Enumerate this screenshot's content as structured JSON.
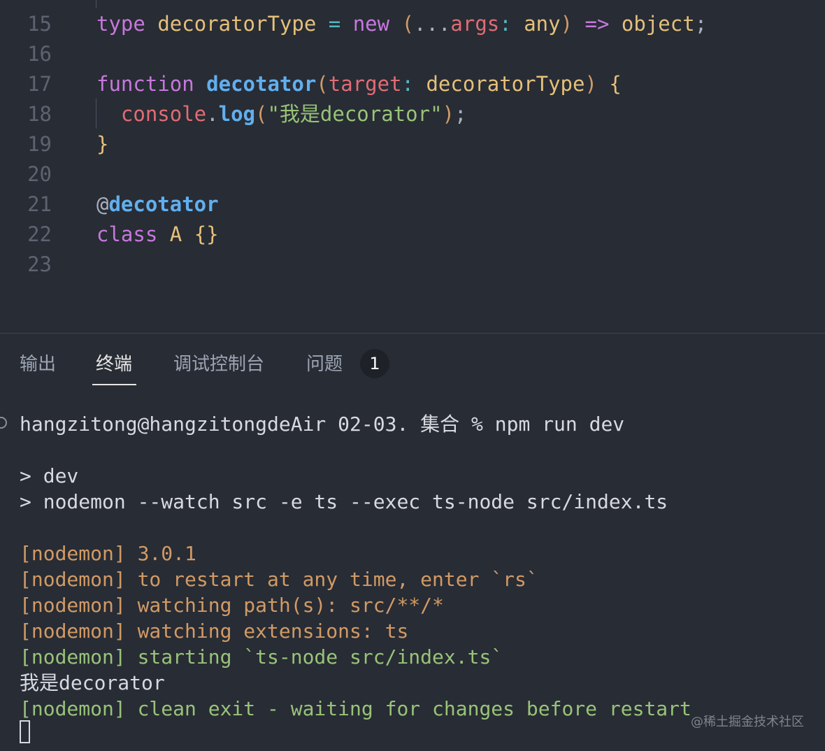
{
  "editor": {
    "lines": [
      {
        "num": "15",
        "tokens": [
          {
            "t": "type",
            "c": "kw"
          },
          {
            "t": " ",
            "c": "pl"
          },
          {
            "t": "decoratorType",
            "c": "ty"
          },
          {
            "t": " ",
            "c": "pl"
          },
          {
            "t": "=",
            "c": "op"
          },
          {
            "t": " ",
            "c": "pl"
          },
          {
            "t": "new",
            "c": "kw"
          },
          {
            "t": " ",
            "c": "pl"
          },
          {
            "t": "(",
            "c": "par"
          },
          {
            "t": "...",
            "c": "pl"
          },
          {
            "t": "args",
            "c": "var"
          },
          {
            "t": ":",
            "c": "op"
          },
          {
            "t": " ",
            "c": "pl"
          },
          {
            "t": "any",
            "c": "ty"
          },
          {
            "t": ")",
            "c": "par"
          },
          {
            "t": " ",
            "c": "pl"
          },
          {
            "t": "=>",
            "c": "kw"
          },
          {
            "t": " ",
            "c": "pl"
          },
          {
            "t": "object",
            "c": "ty"
          },
          {
            "t": ";",
            "c": "pl"
          }
        ]
      },
      {
        "num": "16",
        "tokens": []
      },
      {
        "num": "17",
        "tokens": [
          {
            "t": "function",
            "c": "kw"
          },
          {
            "t": " ",
            "c": "pl"
          },
          {
            "t": "decotator",
            "c": "fn"
          },
          {
            "t": "(",
            "c": "par"
          },
          {
            "t": "target",
            "c": "var"
          },
          {
            "t": ":",
            "c": "op"
          },
          {
            "t": " ",
            "c": "pl"
          },
          {
            "t": "decoratorType",
            "c": "ty"
          },
          {
            "t": ")",
            "c": "par"
          },
          {
            "t": " ",
            "c": "pl"
          },
          {
            "t": "{",
            "c": "brace"
          }
        ]
      },
      {
        "num": "18",
        "tokens": [
          {
            "t": "  ",
            "c": "pl"
          },
          {
            "t": "console",
            "c": "var"
          },
          {
            "t": ".",
            "c": "pl"
          },
          {
            "t": "log",
            "c": "fn"
          },
          {
            "t": "(",
            "c": "par"
          },
          {
            "t": "\"我是decorator\"",
            "c": "str"
          },
          {
            "t": ")",
            "c": "par"
          },
          {
            "t": ";",
            "c": "pl"
          }
        ]
      },
      {
        "num": "19",
        "tokens": [
          {
            "t": "}",
            "c": "brace"
          }
        ]
      },
      {
        "num": "20",
        "tokens": []
      },
      {
        "num": "21",
        "tokens": [
          {
            "t": "@",
            "c": "pl"
          },
          {
            "t": "decotator",
            "c": "fn"
          }
        ]
      },
      {
        "num": "22",
        "tokens": [
          {
            "t": "class",
            "c": "kw"
          },
          {
            "t": " ",
            "c": "pl"
          },
          {
            "t": "A",
            "c": "ty"
          },
          {
            "t": " ",
            "c": "pl"
          },
          {
            "t": "{}",
            "c": "brace"
          }
        ]
      },
      {
        "num": "23",
        "tokens": []
      }
    ]
  },
  "panel": {
    "tabs": [
      {
        "label": "输出",
        "active": false
      },
      {
        "label": "终端",
        "active": true
      },
      {
        "label": "调试控制台",
        "active": false
      },
      {
        "label": "问题",
        "active": false
      }
    ],
    "problems_count": "1"
  },
  "terminal": {
    "lines": [
      {
        "text": "hangzitong@hangzitongdeAir 02-03. 集合 % npm run dev",
        "color": "default"
      },
      {
        "text": "",
        "color": "default"
      },
      {
        "text": "> dev",
        "color": "default"
      },
      {
        "text": "> nodemon --watch src -e ts --exec ts-node src/index.ts",
        "color": "default"
      },
      {
        "text": "",
        "color": "default"
      },
      {
        "text": "[nodemon] 3.0.1",
        "color": "yellow"
      },
      {
        "text": "[nodemon] to restart at any time, enter `rs`",
        "color": "yellow"
      },
      {
        "text": "[nodemon] watching path(s): src/**/*",
        "color": "yellow"
      },
      {
        "text": "[nodemon] watching extensions: ts",
        "color": "yellow"
      },
      {
        "text": "[nodemon] starting `ts-node src/index.ts`",
        "color": "green"
      },
      {
        "text": "我是decorator",
        "color": "default"
      },
      {
        "text": "[nodemon] clean exit - waiting for changes before restart",
        "color": "green"
      }
    ]
  },
  "watermark": "@稀土掘金技术社区",
  "colors": {
    "background": "#282c34",
    "keyword": "#c678dd",
    "type": "#e5c07b",
    "function": "#61afef",
    "variable": "#e06c75",
    "string": "#98c379",
    "nodemon_yellow": "#d19a66",
    "nodemon_green": "#98c379"
  }
}
